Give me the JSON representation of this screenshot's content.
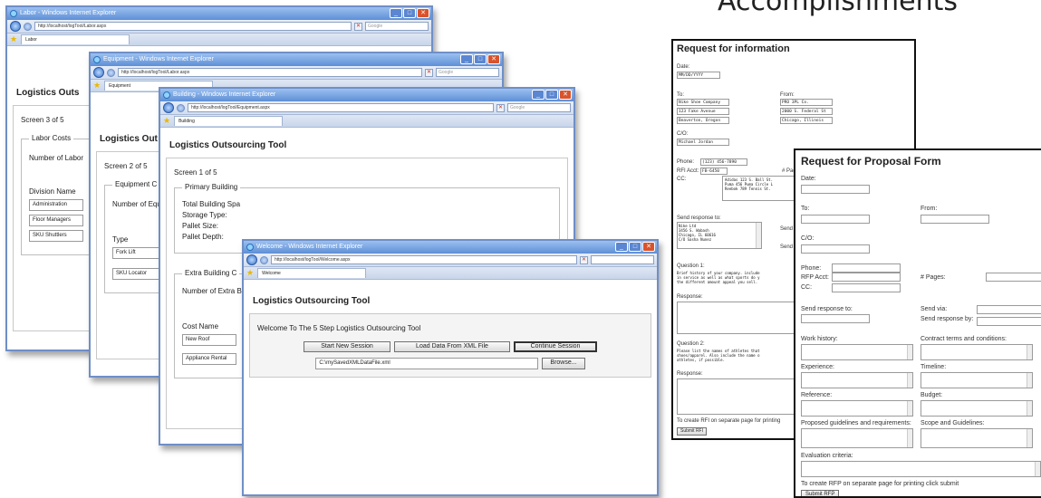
{
  "heading": "Accomplishments",
  "windows": {
    "labor": {
      "title": "Labor - Windows Internet Explorer",
      "url": "http://localhost/logTool/Labor.aspx",
      "tab": "Labor",
      "app_title": "Logistics Outs",
      "screen": "Screen 3 of 5",
      "legend": "Labor Costs",
      "count_label": "Number of Labor",
      "col_label": "Division Name",
      "rows": [
        "Administration",
        "Floor Managers",
        "SKU Shuttlers"
      ]
    },
    "equipment": {
      "title": "Equipment - Windows Internet Explorer",
      "url": "http://localhost/logTool/Labor.aspx",
      "tab": "Equipment",
      "app_title": "Logistics Out",
      "screen": "Screen 2 of 5",
      "legend": "Equipment C",
      "count_label": "Number of Equ",
      "col_label": "Type",
      "rows": [
        "Fork Lift",
        "SKU Locator"
      ]
    },
    "building": {
      "title": "Building - Windows Internet Explorer",
      "url": "http://localhost/logTool/Equipment.aspx",
      "tab": "Building",
      "app_title": "Logistics Outsourcing Tool",
      "screen": "Screen 1 of 5",
      "legend1": "Primary Building",
      "fields": [
        "Total Building Spa",
        "Storage Type:",
        "Pallet Size:",
        "Pallet Depth:"
      ],
      "legend2": "Extra Building C",
      "count_label": "Number of Extra B",
      "col_label": "Cost Name",
      "rows": [
        "New Roof",
        "Appliance Rental"
      ]
    },
    "welcome": {
      "title": "Welcome - Windows Internet Explorer",
      "url": "http://localhost/logTool/Welcome.aspx",
      "tab": "Welcome",
      "app_title": "Logistics Outsourcing Tool",
      "intro": "Welcome To The 5 Step Logistics Outsourcing Tool",
      "buttons": [
        "Start New Session",
        "Load Data From XML File",
        "Continue Session"
      ],
      "file_path": "C:\\mySavedXMLDataFile.xml",
      "browse": "Browse..."
    },
    "search_placeholder": "Google"
  },
  "rfi": {
    "title": "Request for information",
    "date_label": "Date:",
    "date_value": "MM/DD/YYYY",
    "to_label": "To:",
    "to_lines": [
      "Nike Shoe Company",
      "123 Fake Avenue",
      "Beaverton, Oregon"
    ],
    "from_label": "From:",
    "from_lines": [
      "PRO 3PL Co.",
      "2000 S. Federal St",
      "Chicago, Illinois"
    ],
    "co_label": "C/O:",
    "co_value": "Michael Jordan",
    "phone_label": "Phone:",
    "phone_value": "(123) 456-7890",
    "rfiacct_label": "RFI Acct:",
    "rfiacct_value": "FB-6450",
    "pages_label": "# Pages",
    "cc_label": "CC:",
    "cc_text": "Adidas 123 S. Ball St.\nPuma 456 Puma Circle L\nReebok 789 Tennis St.",
    "sendto_label": "Send response to:",
    "sendto_text": "Nike Ltd\n3456 S. Wabash\nChicago, IL 60616\nC/O Sasha Nunez",
    "send_label": "Send",
    "q1_label": "Question 1:",
    "q1_text": "Brief history of your company. include\nin service as well as what sports do y\nthe different amount appeal you sell.",
    "response_label": "Response:",
    "q2_label": "Question 2:",
    "q2_text": "Please list the names of athletes that\nshoes/apparel. Also include the name o\nathletes, if possible.",
    "response2_label": "Response:",
    "footer": "To create RFI on separate page for printing",
    "submit": "Submit RFI"
  },
  "rfp": {
    "title": "Request for Proposal Form",
    "labels": {
      "date": "Date:",
      "to": "To:",
      "from": "From:",
      "co": "C/O:",
      "phone": "Phone:",
      "rfpacct": "RFP Acct:",
      "pages": "# Pages:",
      "cc": "CC:",
      "sendto": "Send response to:",
      "sendvia": "Send via:",
      "sendby": "Send response by:",
      "work": "Work history:",
      "contract": "Contract terms and conditions:",
      "experience": "Experience:",
      "timeline": "Timeline:",
      "reference": "Reference:",
      "budget": "Budget:",
      "proposed": "Proposed guidelines and requirements:",
      "scope": "Scope and Guidelines:",
      "evaluation": "Evaluation criteria:"
    },
    "footer": "To create RFP on separate page for printing click submit",
    "submit": "Submit RFP"
  }
}
